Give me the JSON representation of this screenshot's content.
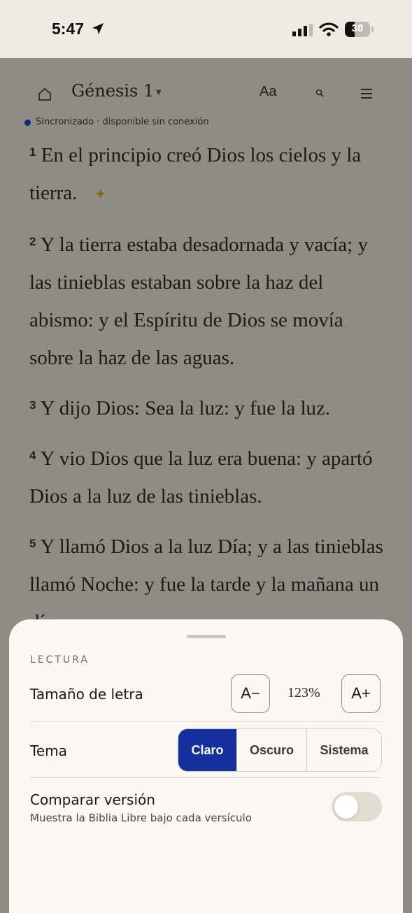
{
  "status": {
    "time": "5:47",
    "battery": "38"
  },
  "toolbar": {
    "chapter": "Génesis 1",
    "font_button": "Aa"
  },
  "sync": {
    "text": "Sincronizado · disponible sin conexión"
  },
  "verses": [
    {
      "n": "1",
      "text": "En el principio creó Dios los cielos y la tierra."
    },
    {
      "n": "2",
      "text": "Y la tierra estaba desadornada y vacía; y las tinieblas estaban sobre la haz del abismo: y el Espíritu de Dios se movía sobre la haz de las aguas."
    },
    {
      "n": "3",
      "text": "Y dijo Dios: Sea la luz: y fue la luz."
    },
    {
      "n": "4",
      "text": "Y vio Dios que la luz era buena: y apartó Dios a la luz de las tinieblas."
    },
    {
      "n": "5",
      "text": "Y llamó Dios a la luz Día; y a las tinieblas llamó Noche: y fue la tarde y la mañana un día."
    }
  ],
  "sheet": {
    "section_title": "LECTURA",
    "font_size": {
      "label": "Tamaño de letra",
      "decrease": "A−",
      "increase": "A+",
      "value": "123%"
    },
    "theme": {
      "label": "Tema",
      "options": [
        "Claro",
        "Oscuro",
        "Sistema"
      ],
      "selected": "Claro"
    },
    "compare": {
      "label": "Comparar versión",
      "description": "Muestra la Biblia Libre bajo cada versículo",
      "enabled": false
    }
  }
}
